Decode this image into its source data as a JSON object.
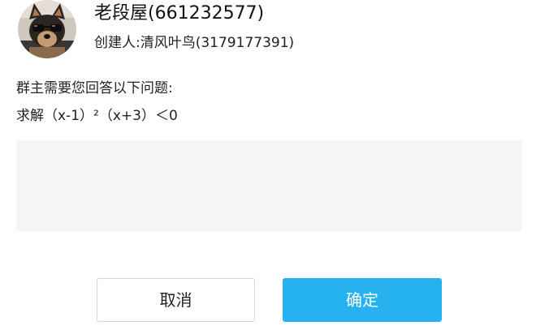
{
  "group": {
    "name": "老段屋(661232577)",
    "creator": "创建人:清风叶鸟(3179177391)"
  },
  "question": {
    "prompt": "群主需要您回答以下问题:",
    "text": "求解（x-1）²（x+3）＜0"
  },
  "answer": {
    "value": "",
    "placeholder": ""
  },
  "buttons": {
    "cancel_label": "取消",
    "confirm_label": "确定"
  },
  "colors": {
    "accent": "#26b2ef",
    "input_background": "#f5f5f5"
  },
  "icons": {
    "avatar": "group-avatar-chihuahua-with-sunglasses"
  }
}
